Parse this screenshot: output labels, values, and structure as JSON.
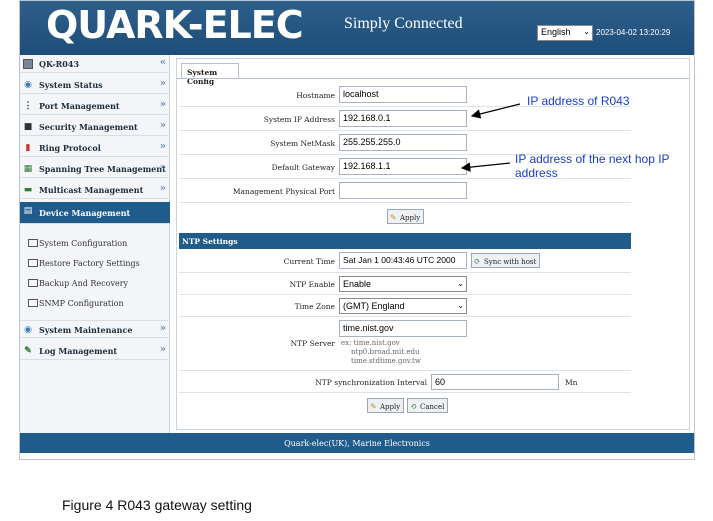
{
  "header": {
    "logo": "QUARK-ELEC",
    "tagline": "Simply Connected",
    "language": "English",
    "datetime": "2023-04-02 13:20:29"
  },
  "sidebar": {
    "items": [
      {
        "label": "QK-R043",
        "icon": "device-icon"
      },
      {
        "label": "System Status",
        "icon": "globe-icon"
      },
      {
        "label": "Port Management",
        "icon": "port-icon"
      },
      {
        "label": "Security Management",
        "icon": "lock-icon"
      },
      {
        "label": "Ring Protocol",
        "icon": "ring-icon"
      },
      {
        "label": "Spanning Tree Management",
        "icon": "tree-icon"
      },
      {
        "label": "Multicast Management",
        "icon": "multicast-icon"
      },
      {
        "label": "Device Management",
        "icon": "device-management-icon"
      },
      {
        "label": "System Maintenance",
        "icon": "maintenance-icon"
      },
      {
        "label": "Log Management",
        "icon": "log-icon"
      }
    ],
    "subitems": [
      "System Configuration",
      "Restore Factory Settings",
      "Backup And Recovery",
      "SNMP Configuration"
    ]
  },
  "tab": {
    "label": "System Config"
  },
  "config": {
    "hostname_label": "Hostname",
    "hostname": "localhost",
    "ip_label": "System IP Address",
    "ip": "192.168.0.1",
    "netmask_label": "System NetMask",
    "netmask": "255.255.255.0",
    "gateway_label": "Default Gateway",
    "gateway": "192.168.1.1",
    "mgmt_port_label": "Management Physical Port",
    "mgmt_port": "",
    "apply_label": "Apply"
  },
  "ntp": {
    "section_title": "NTP Settings",
    "current_time_label": "Current Time",
    "current_time": "Sat Jan  1 00:43:46 UTC 2000",
    "sync_label": "Sync with host",
    "enable_label": "NTP Enable",
    "enable_value": "Enable",
    "timezone_label": "Time Zone",
    "timezone_value": "(GMT) England",
    "server_label": "NTP Server",
    "server_value": "time.nist.gov",
    "server_hint_1": "ex: time.nist.gov",
    "server_hint_2": "ntp0.broad.mit.edu",
    "server_hint_3": "time.stdtime.gov.tw",
    "interval_label": "NTP synchronization Interval",
    "interval_value": "60",
    "interval_unit": "Mn",
    "apply_label": "Apply",
    "cancel_label": "Cancel"
  },
  "footer": {
    "text": "Quark-elec(UK), Marine Electronics"
  },
  "annotations": {
    "ip_note": "IP address of R043",
    "gateway_note_1": "IP address of the next hop IP",
    "gateway_note_2": "address"
  },
  "caption": "Figure 4 R043 gateway setting",
  "colors": {
    "header": "#1f5c8c",
    "annotation": "#1a3ccc"
  }
}
